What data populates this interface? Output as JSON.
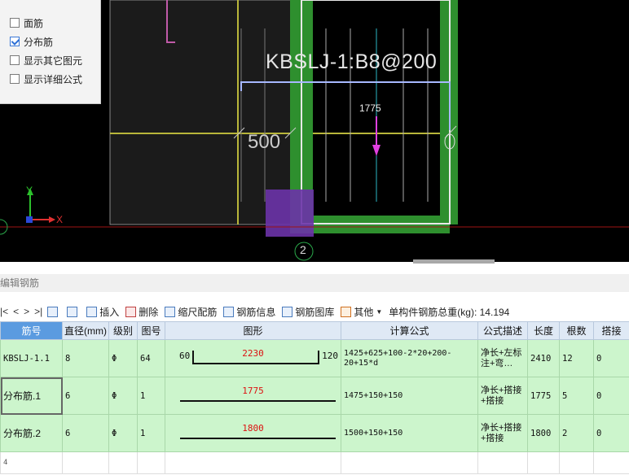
{
  "canvas": {
    "annotation_label": "KBSLJ-1:B8@200",
    "dim_1775": "1775",
    "dim_500": "500",
    "axis_marker": "2",
    "axis_y": "Y",
    "axis_x": "X"
  },
  "options": [
    {
      "label": "面筋",
      "checked": false
    },
    {
      "label": "分布筋",
      "checked": true
    },
    {
      "label": "显示其它图元",
      "checked": false
    },
    {
      "label": "显示详细公式",
      "checked": false
    }
  ],
  "section_title": "编辑钢筋",
  "toolbar": {
    "nav": [
      "|<",
      "<",
      ">",
      ">|"
    ],
    "insert": "插入",
    "delete": "删除",
    "scale": "缩尺配筋",
    "info": "钢筋信息",
    "library": "钢筋图库",
    "other": "其他",
    "weight_label": "单构件钢筋总重(kg): 14.194"
  },
  "table": {
    "headers": [
      "筋号",
      "直径(mm)",
      "级别",
      "图号",
      "图形",
      "计算公式",
      "公式描述",
      "长度",
      "根数",
      "搭接"
    ],
    "rows": [
      {
        "name": "KBSLJ-1.1",
        "diameter": "8",
        "grade": "Φ",
        "fig": "64",
        "shape_left": "60",
        "shape_mid": "2230",
        "shape_right": "120",
        "formula": "1425+625+100-2*20+200-20+15*d",
        "desc": "净长+左标注+弯…",
        "length": "2410",
        "count": "12",
        "lap": "0"
      },
      {
        "name": "分布筋.1",
        "diameter": "6",
        "grade": "Φ",
        "fig": "1",
        "shape_left": "",
        "shape_mid": "1775",
        "shape_right": "",
        "formula": "1475+150+150",
        "desc": "净长+搭接+搭接",
        "length": "1775",
        "count": "5",
        "lap": "0"
      },
      {
        "name": "分布筋.2",
        "diameter": "6",
        "grade": "Φ",
        "fig": "1",
        "shape_left": "",
        "shape_mid": "1800",
        "shape_right": "",
        "formula": "1500+150+150",
        "desc": "净长+搭接+搭接",
        "length": "1800",
        "count": "2",
        "lap": "0"
      }
    ],
    "last_row_marker": "4"
  }
}
